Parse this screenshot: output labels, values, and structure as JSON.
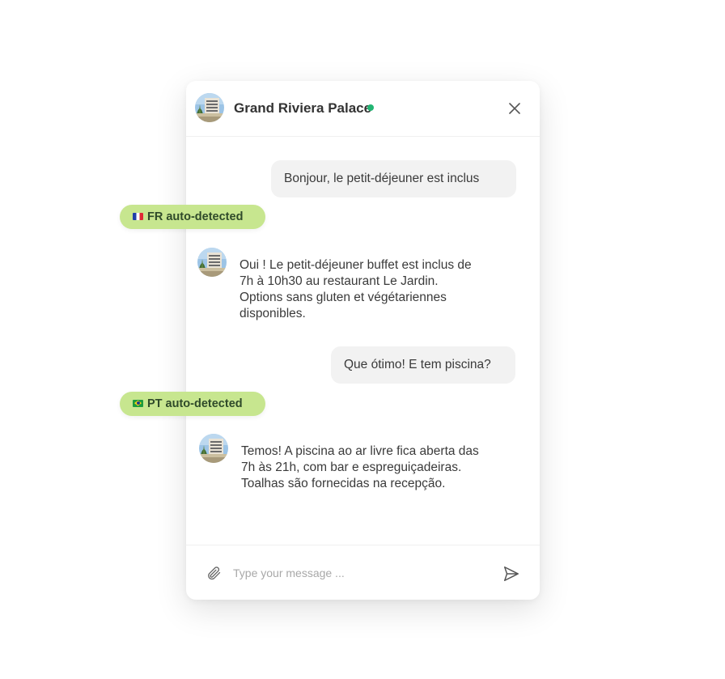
{
  "header": {
    "hotel_name": "Grand Riviera Palace",
    "status": "online",
    "status_color": "#22b573",
    "avatar_icon": "hotel-photo-avatar",
    "close_icon": "close-icon"
  },
  "messages": [
    {
      "sender": "user",
      "text": "Bonjour, le petit-déjeuner est inclus"
    },
    {
      "sender": "hotel",
      "text": "Oui ! Le petit-déjeuner buffet est inclus de\n7h à 10h30 au restaurant Le Jardin.\nOptions sans gluten et végétariennes\ndisponibles."
    },
    {
      "sender": "user",
      "text": "Que ótimo! E tem piscina?"
    },
    {
      "sender": "hotel",
      "text": "Temos! A piscina ao ar livre fica aberta das\n7h às 21h, com bar e espreguiçadeiras.\nToalhas são fornecidas na recepção."
    }
  ],
  "badges": {
    "fr": {
      "flag": "france-flag",
      "label": "FR auto-detected"
    },
    "pt": {
      "flag": "brazil-flag",
      "label": "PT auto-detected"
    },
    "color": "#c7e68f"
  },
  "composer": {
    "placeholder": "Type your message ...",
    "value": "",
    "attach_icon": "paperclip-icon",
    "send_icon": "send-icon"
  }
}
